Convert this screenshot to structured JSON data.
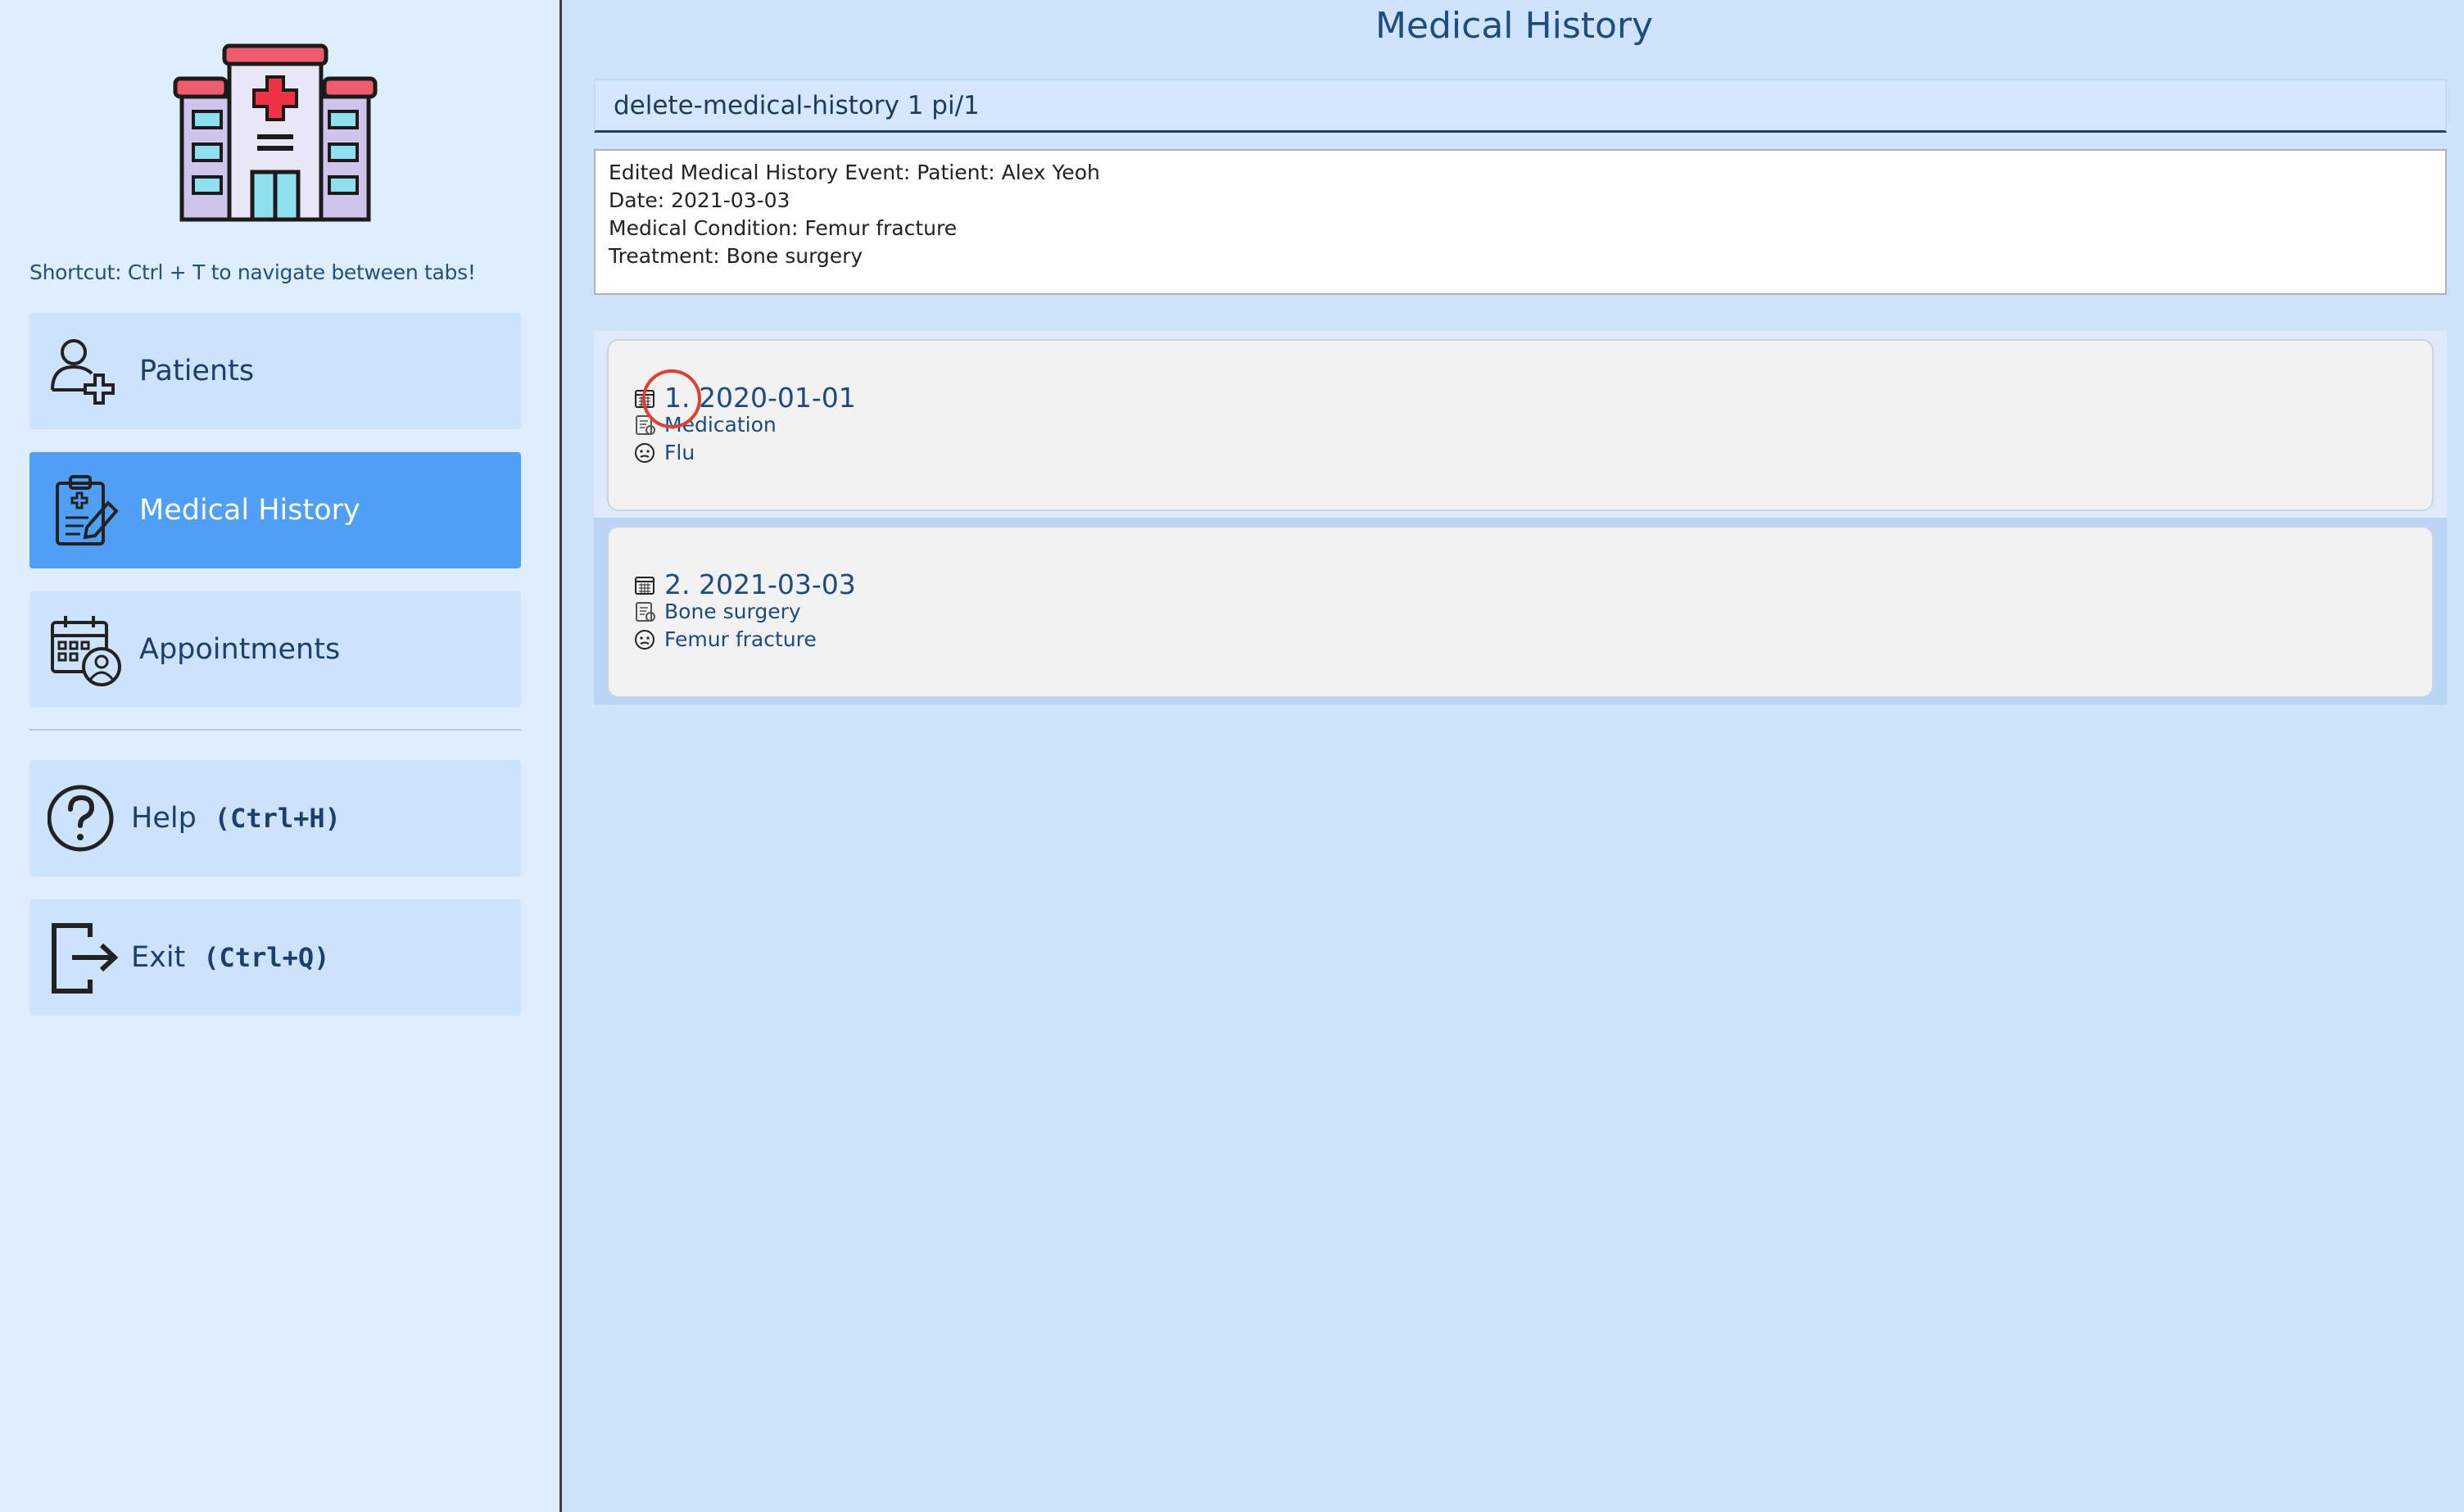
{
  "sidebar": {
    "shortcut_hint": "Shortcut: Ctrl + T to navigate between tabs!",
    "items": [
      {
        "label": "Patients",
        "icon": "add-user-icon"
      },
      {
        "label": "Medical History",
        "icon": "clipboard-icon",
        "active": true
      },
      {
        "label": "Appointments",
        "icon": "calendar-doctor-icon"
      }
    ],
    "help": {
      "label": "Help",
      "shortcut": "(Ctrl+H)",
      "icon": "question-circle-icon"
    },
    "exit": {
      "label": "Exit",
      "shortcut": "(Ctrl+Q)",
      "icon": "exit-icon"
    }
  },
  "main": {
    "title": "Medical History",
    "command": "delete-medical-history 1 pi/1",
    "result_lines": [
      "Edited Medical History Event: Patient: Alex Yeoh",
      "Date: 2021-03-03",
      "Medical Condition: Femur fracture",
      "Treatment: Bone surgery"
    ],
    "records": [
      {
        "title": "1. 2020-01-01",
        "treatment": "Medication",
        "condition": "Flu"
      },
      {
        "title": "2. 2021-03-03",
        "treatment": "Bone surgery",
        "condition": "Femur fracture"
      }
    ]
  },
  "colors": {
    "background": "#cfe4fb",
    "sidebar": "#deeefd",
    "active_tab": "#4f9ff7",
    "click_marker": "#e04030"
  }
}
